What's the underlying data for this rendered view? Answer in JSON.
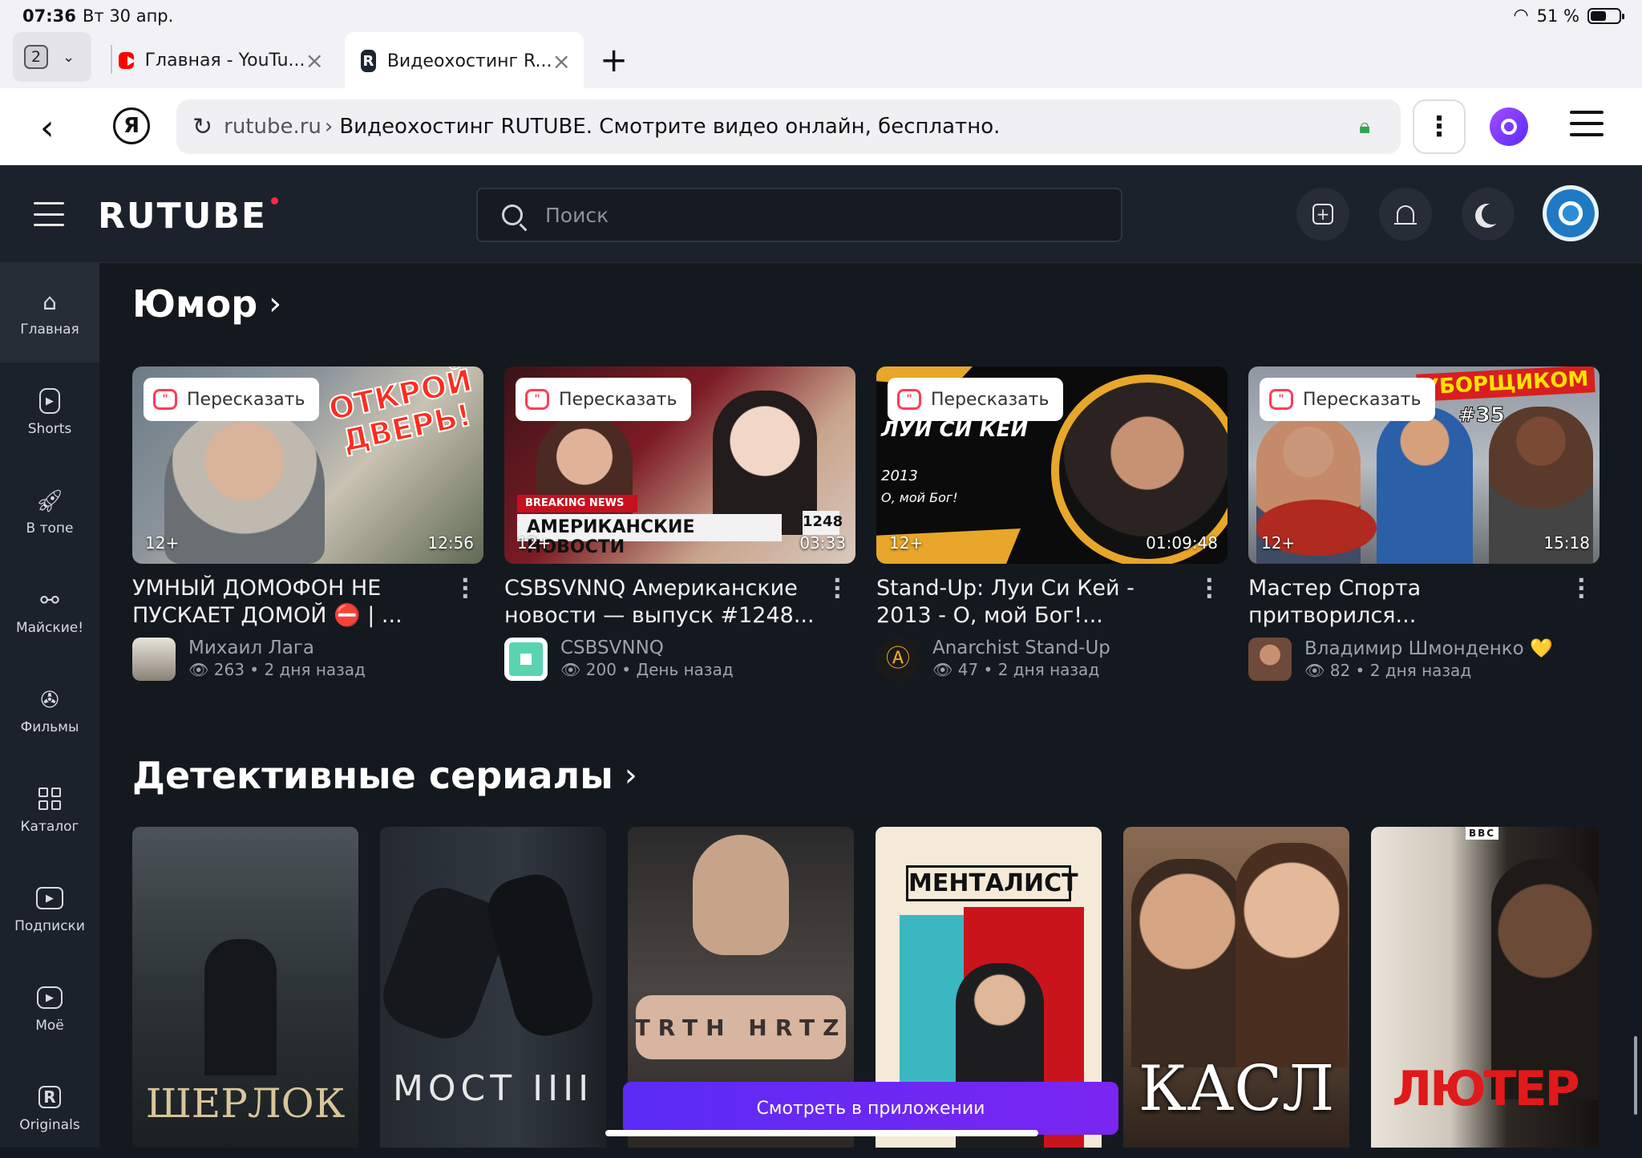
{
  "status_bar": {
    "time": "07:36",
    "date": "Вт 30 апр.",
    "battery": "51 %"
  },
  "browser": {
    "tab_count": "2",
    "tabs": [
      {
        "title": "Главная - YouTu..."
      },
      {
        "title": "Видеохостинг R..."
      }
    ],
    "address": {
      "domain": "rutube.ru",
      "separator": "›",
      "page_title": "Видеохостинг RUTUBE. Смотрите видео онлайн, бесплатно."
    },
    "ya_label": "Я"
  },
  "site": {
    "logo": "RUTUBE",
    "search_placeholder": "Поиск",
    "sidebar": [
      {
        "label": "Главная",
        "icon": "home-icon"
      },
      {
        "label": "Shorts",
        "icon": "shorts-icon"
      },
      {
        "label": "В топе",
        "icon": "rocket-icon"
      },
      {
        "label": "Майские!",
        "icon": "grill-icon"
      },
      {
        "label": "Фильмы",
        "icon": "film-reel-icon"
      },
      {
        "label": "Каталог",
        "icon": "grid-icon"
      },
      {
        "label": "Подписки",
        "icon": "subscriptions-icon"
      },
      {
        "label": "Моё",
        "icon": "my-videos-icon"
      },
      {
        "label": "Originals",
        "icon": "originals-icon"
      }
    ]
  },
  "humor": {
    "title": "Юмор",
    "retell_label": "Пересказать",
    "videos": [
      {
        "thumb_text": "ОТКРОЙ ДВЕРЬ!",
        "age": "12+",
        "duration": "12:56",
        "title": "УМНЫЙ ДОМОФОН НЕ ПУСКАЕТ ДОМОЙ ⛔ | ...",
        "channel": "Михаил Лага",
        "views": "263",
        "date": "2 дня назад"
      },
      {
        "thumb_text": "АМЕРИКАНСКИЕ НОВОСТИ",
        "thumb_badge": "BREAKING NEWS",
        "thumb_episode": "1248",
        "age": "12+",
        "duration": "03:33",
        "title": "CSBSVNNQ Американские новости — выпуск #1248...",
        "channel": "CSBSVNNQ",
        "views": "200",
        "date": "День назад"
      },
      {
        "thumb_text": "ЛУИ СИ КЕЙ",
        "thumb_sub": "2013",
        "thumb_sub2": "О, мой Бог!",
        "age": "12+",
        "duration": "01:09:48",
        "title": "Stand-Up: Луи Си Кей - 2013 - О, мой Бог!...",
        "channel": "Anarchist Stand-Up",
        "views": "47",
        "date": "2 дня назад"
      },
      {
        "thumb_text": "УБОРЩИКОМ",
        "thumb_sub": "#35",
        "age": "12+",
        "duration": "15:18",
        "title": "Мастер Спорта притворился...",
        "channel": "Владимир Шмонденко 💛",
        "views": "82",
        "date": "2 дня назад"
      }
    ]
  },
  "detective": {
    "title": "Детективные сериалы",
    "posters": [
      {
        "title": "ШЕРЛОК"
      },
      {
        "title": "МОСТ IIII"
      },
      {
        "title": "TRTH HRTZ"
      },
      {
        "title": "МЕНТАЛИСТ"
      },
      {
        "title": "КАСЛ"
      },
      {
        "title": "ЛЮТЕР",
        "badge": "BBC"
      }
    ]
  },
  "app_button": "Смотреть в приложении",
  "colors": {
    "bg": "#14191f",
    "panel": "#1c222b",
    "accent": "#ff2a4b",
    "app_button": "#6a29f3"
  }
}
